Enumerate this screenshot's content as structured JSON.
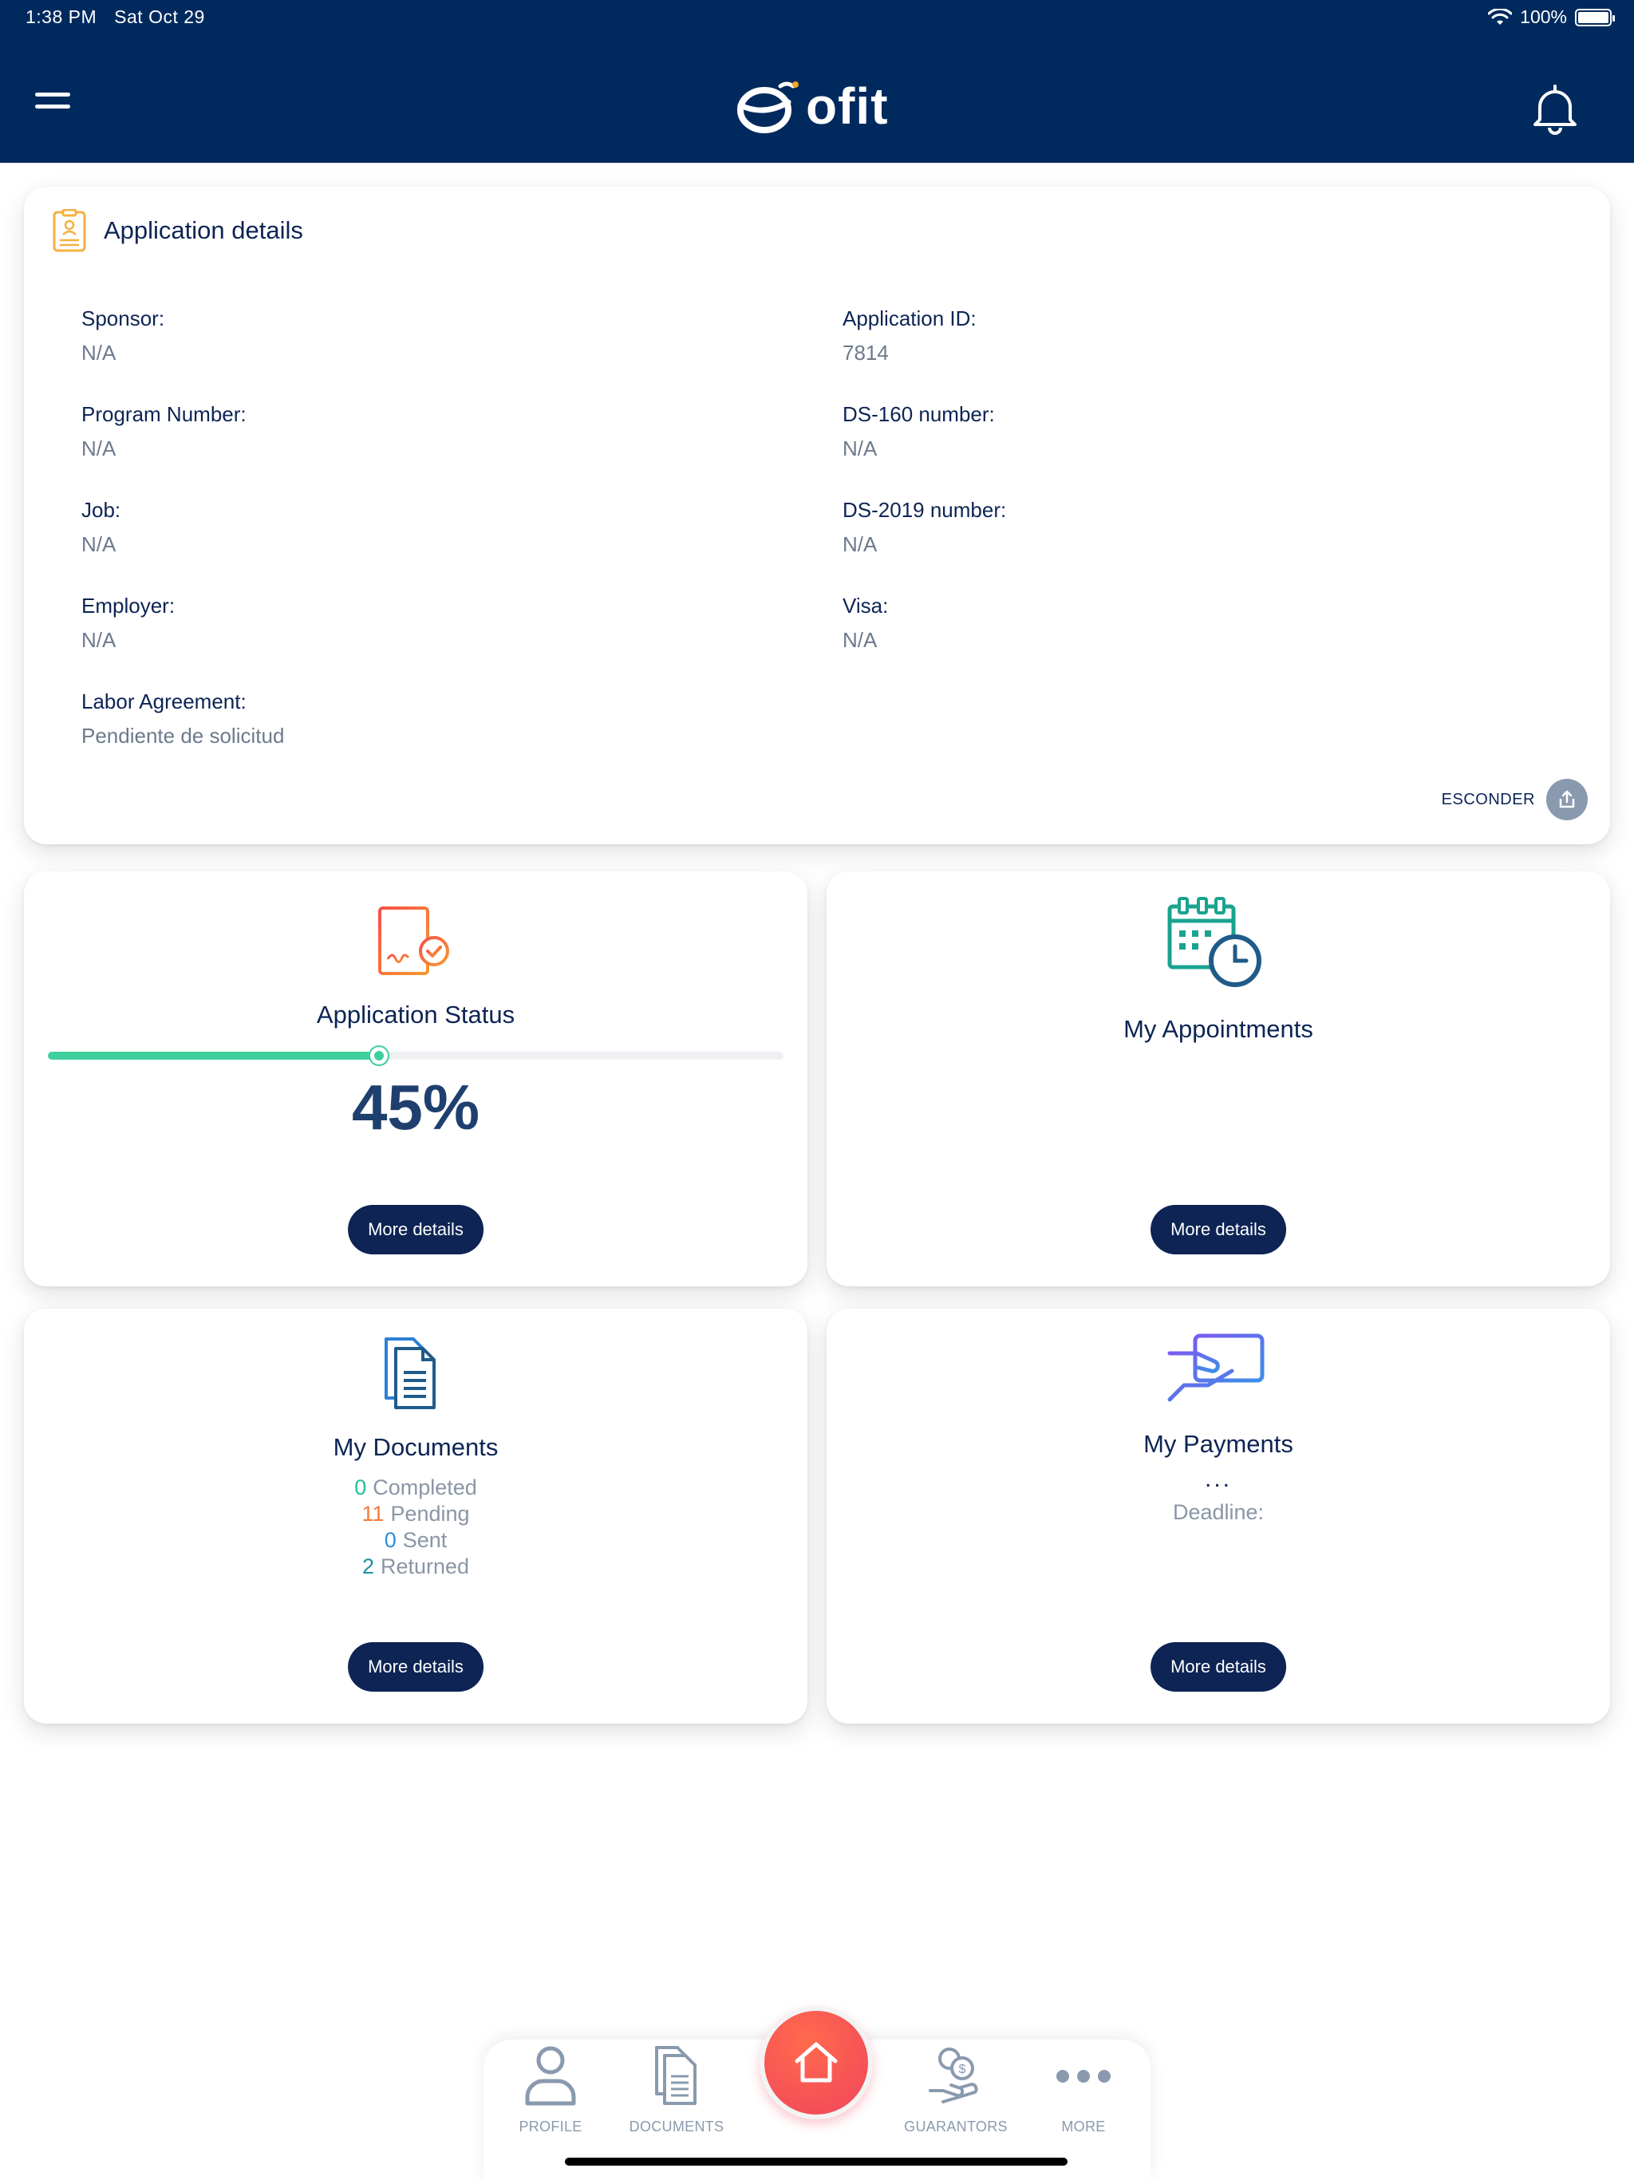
{
  "status_bar": {
    "time": "1:38 PM",
    "date": "Sat Oct 29",
    "battery": "100%"
  },
  "header": {
    "logo_text": "ofit"
  },
  "application_details": {
    "title": "Application details",
    "fields": [
      {
        "label": "Sponsor:",
        "value": "N/A"
      },
      {
        "label": "Application ID:",
        "value": "7814"
      },
      {
        "label": "Program Number:",
        "value": "N/A"
      },
      {
        "label": "DS-160 number:",
        "value": "N/A"
      },
      {
        "label": "Job:",
        "value": "N/A"
      },
      {
        "label": "DS-2019 number:",
        "value": "N/A"
      },
      {
        "label": "Employer:",
        "value": "N/A"
      },
      {
        "label": "Visa:",
        "value": "N/A"
      },
      {
        "label": "Labor Agreement:",
        "value": "Pendiente de solicitud"
      }
    ],
    "hide_label": "ESCONDER"
  },
  "application_status": {
    "title": "Application Status",
    "percent_text": "45%",
    "progress": 0.45,
    "button": "More details"
  },
  "appointments": {
    "title": "My Appointments",
    "button": "More details"
  },
  "documents": {
    "title": "My Documents",
    "stats": [
      {
        "count": "0",
        "label": "Completed",
        "color": "#1fbf9a"
      },
      {
        "count": "11",
        "label": "Pending",
        "color": "#f27a3a"
      },
      {
        "count": "0",
        "label": "Sent",
        "color": "#2a8fe0"
      },
      {
        "count": "2",
        "label": "Returned",
        "color": "#1c8fa0"
      }
    ],
    "button": "More details"
  },
  "payments": {
    "title": "My Payments",
    "dots": "...",
    "deadline_label": "Deadline:",
    "button": "More details"
  },
  "tabbar": {
    "profile": "PROFILE",
    "documents": "DOCUMENTS",
    "guarantors": "GUARANTORS",
    "more": "MORE"
  },
  "colors": {
    "navy": "#002a5e",
    "accent_green": "#3fcf9b",
    "home_button": "#f0455c"
  }
}
